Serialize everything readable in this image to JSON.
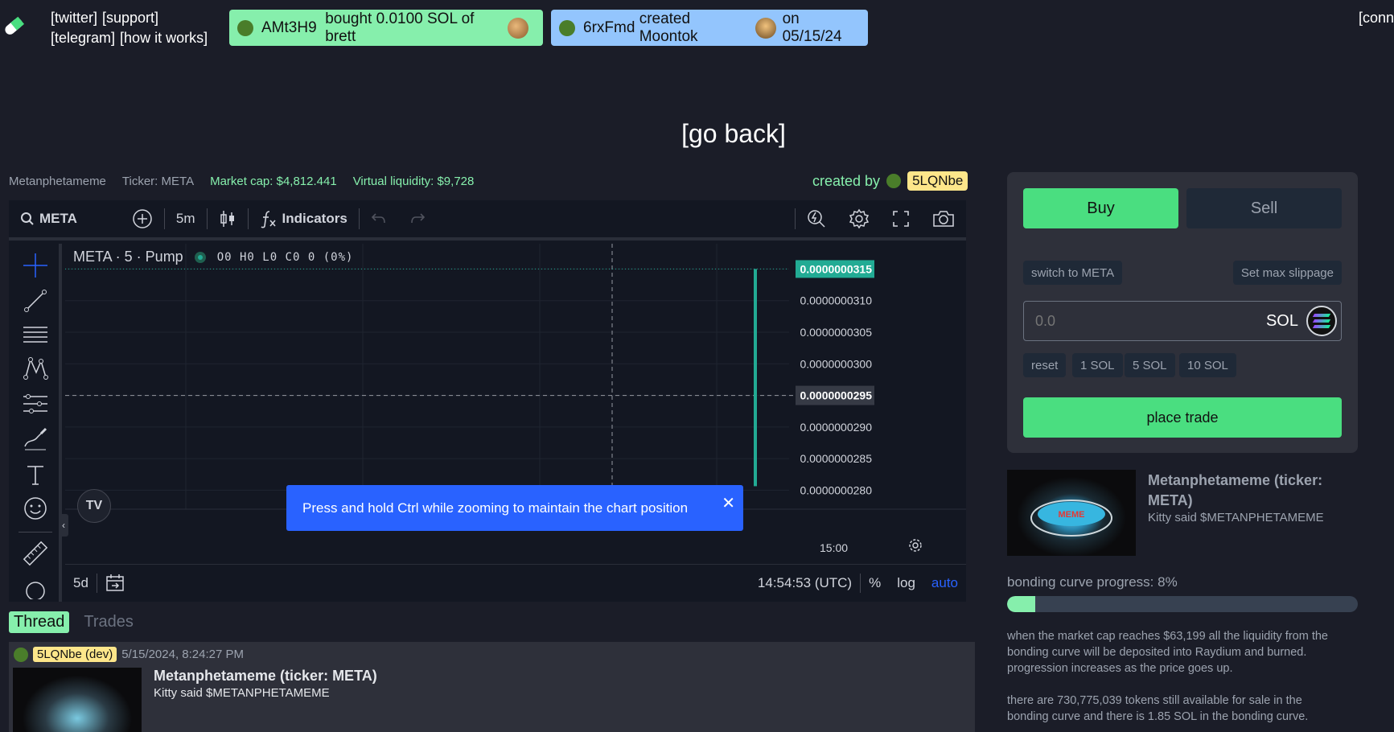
{
  "header": {
    "links_row1": [
      "[twitter]",
      "[support]"
    ],
    "links_row2": [
      "[telegram]",
      "[how it works]"
    ],
    "ticker_buy": {
      "user": "AMt3H9",
      "text": "bought 0.0100 SOL of brett"
    },
    "ticker_create": {
      "user": "6rxFmd",
      "text": "created Moontok",
      "date": "on 05/15/24"
    },
    "connect": "[conn"
  },
  "go_back": "[go back]",
  "token_info": {
    "name": "Metanphetameme",
    "ticker": "Ticker: META",
    "market_cap": "Market cap: $4,812.441",
    "virtual_liquidity": "Virtual liquidity: $9,728",
    "created_by_label": "created by",
    "creator": "5LQNbe"
  },
  "chart": {
    "search": "META",
    "interval": "5m",
    "indicators": "Indicators",
    "legend_title": "META · 5 · Pump",
    "ohlc": "O0 H0 L0 C0 0 (0%)",
    "price_labels": [
      "0.0000000315",
      "0.0000000310",
      "0.0000000305",
      "0.0000000300",
      "0.0000000295",
      "0.0000000290",
      "0.0000000285",
      "0.0000000280"
    ],
    "time_label": "15:00",
    "range": "5d",
    "clock": "14:54:53 (UTC)",
    "pct": "%",
    "log": "log",
    "auto": "auto",
    "toast": "Press and hold Ctrl while zooming to maintain the chart position",
    "colors": {
      "up": "#22ab94",
      "bg": "#131722",
      "highlight": "#2962ff"
    }
  },
  "chart_data": {
    "type": "bar",
    "title": "META · 5 · Pump",
    "xlabel": "",
    "ylabel": "",
    "x": [
      "15:00"
    ],
    "ylim": [
      2.77e-08,
      3.19e-08
    ],
    "series": [
      {
        "values": [
          3.15e-08
        ]
      }
    ],
    "last_price": 3.15e-08,
    "crosshair_price": 2.95e-08
  },
  "thread": {
    "tabs": [
      "Thread",
      "Trades"
    ],
    "post": {
      "user": "5LQNbe (dev)",
      "timestamp": "5/15/2024, 8:24:27 PM",
      "title": "Metanphetameme (ticker: META)",
      "desc": "Kitty said $METANPHETAMEME"
    }
  },
  "trade": {
    "buy": "Buy",
    "sell": "Sell",
    "switch": "switch to META",
    "slippage": "Set max slippage",
    "amount_placeholder": "0.0",
    "currency": "SOL",
    "quick": [
      "reset",
      "1 SOL",
      "5 SOL",
      "10 SOL"
    ],
    "place": "place trade"
  },
  "token_card": {
    "title": "Metanphetameme (ticker: META)",
    "desc": "Kitty said $METANPHETAMEME",
    "image_text": "MEME"
  },
  "bonding": {
    "label": "bonding curve progress: 8%",
    "progress": 0.08,
    "text1": "when the market cap reaches $63,199 all the liquidity from the bonding curve will be deposited into Raydium and burned. progression increases as the price goes up.",
    "text2": "there are 730,775,039 tokens still available for sale in the bonding curve and there is 1.85 SOL in the bonding curve."
  }
}
